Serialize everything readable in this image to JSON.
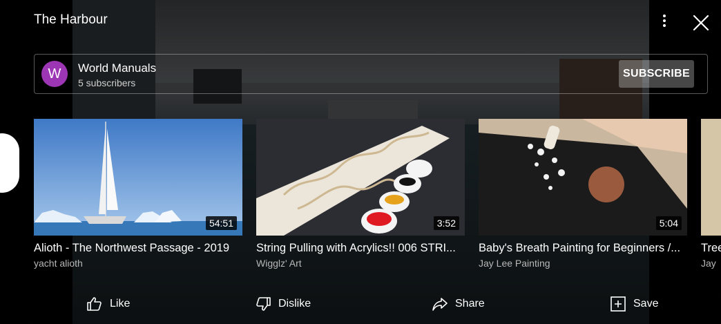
{
  "header": {
    "title": "The Harbour"
  },
  "channel": {
    "avatar_letter": "W",
    "name": "World Manuals",
    "subscribers": "5 subscribers",
    "subscribe_label": "SUBSCRIBE",
    "avatar_color": "#9c36b5"
  },
  "videos": [
    {
      "title": "Alioth - The Northwest Passage - 2019",
      "channel": "yacht alioth",
      "duration": "54:51"
    },
    {
      "title": "String Pulling with Acrylics!! 006 STRI...",
      "channel": "Wigglz' Art",
      "duration": "3:52"
    },
    {
      "title": "Baby's Breath Painting for Beginners /...",
      "channel": "Jay Lee Painting",
      "duration": "5:04"
    },
    {
      "title": "Tree",
      "channel": "Jay"
    }
  ],
  "actions": {
    "like": "Like",
    "dislike": "Dislike",
    "share": "Share",
    "save": "Save"
  },
  "icons": [
    "more-vert-icon",
    "close-icon",
    "thumb-up-icon",
    "thumb-down-icon",
    "share-arrow-icon",
    "playlist-add-icon"
  ]
}
